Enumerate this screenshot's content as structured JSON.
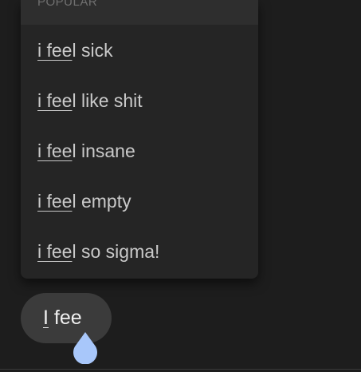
{
  "autocomplete": {
    "section_label": "POPULAR",
    "suggestions": [
      {
        "match": "i fee",
        "rest": "l sick"
      },
      {
        "match": "i fee",
        "rest": "l like shit"
      },
      {
        "match": "i fee",
        "rest": "l insane"
      },
      {
        "match": "i fee",
        "rest": "l empty"
      },
      {
        "match": "i fee",
        "rest": "l so sigma!"
      }
    ]
  },
  "input": {
    "first_word": "I",
    "rest": " fee"
  },
  "colors": {
    "background": "#1d1d1d",
    "dropdown": "#252525",
    "input_bubble": "#3b3b3b",
    "text_handle": "#a8c7fa"
  },
  "icons": {
    "text_handle": "text-selection-handle-icon"
  }
}
